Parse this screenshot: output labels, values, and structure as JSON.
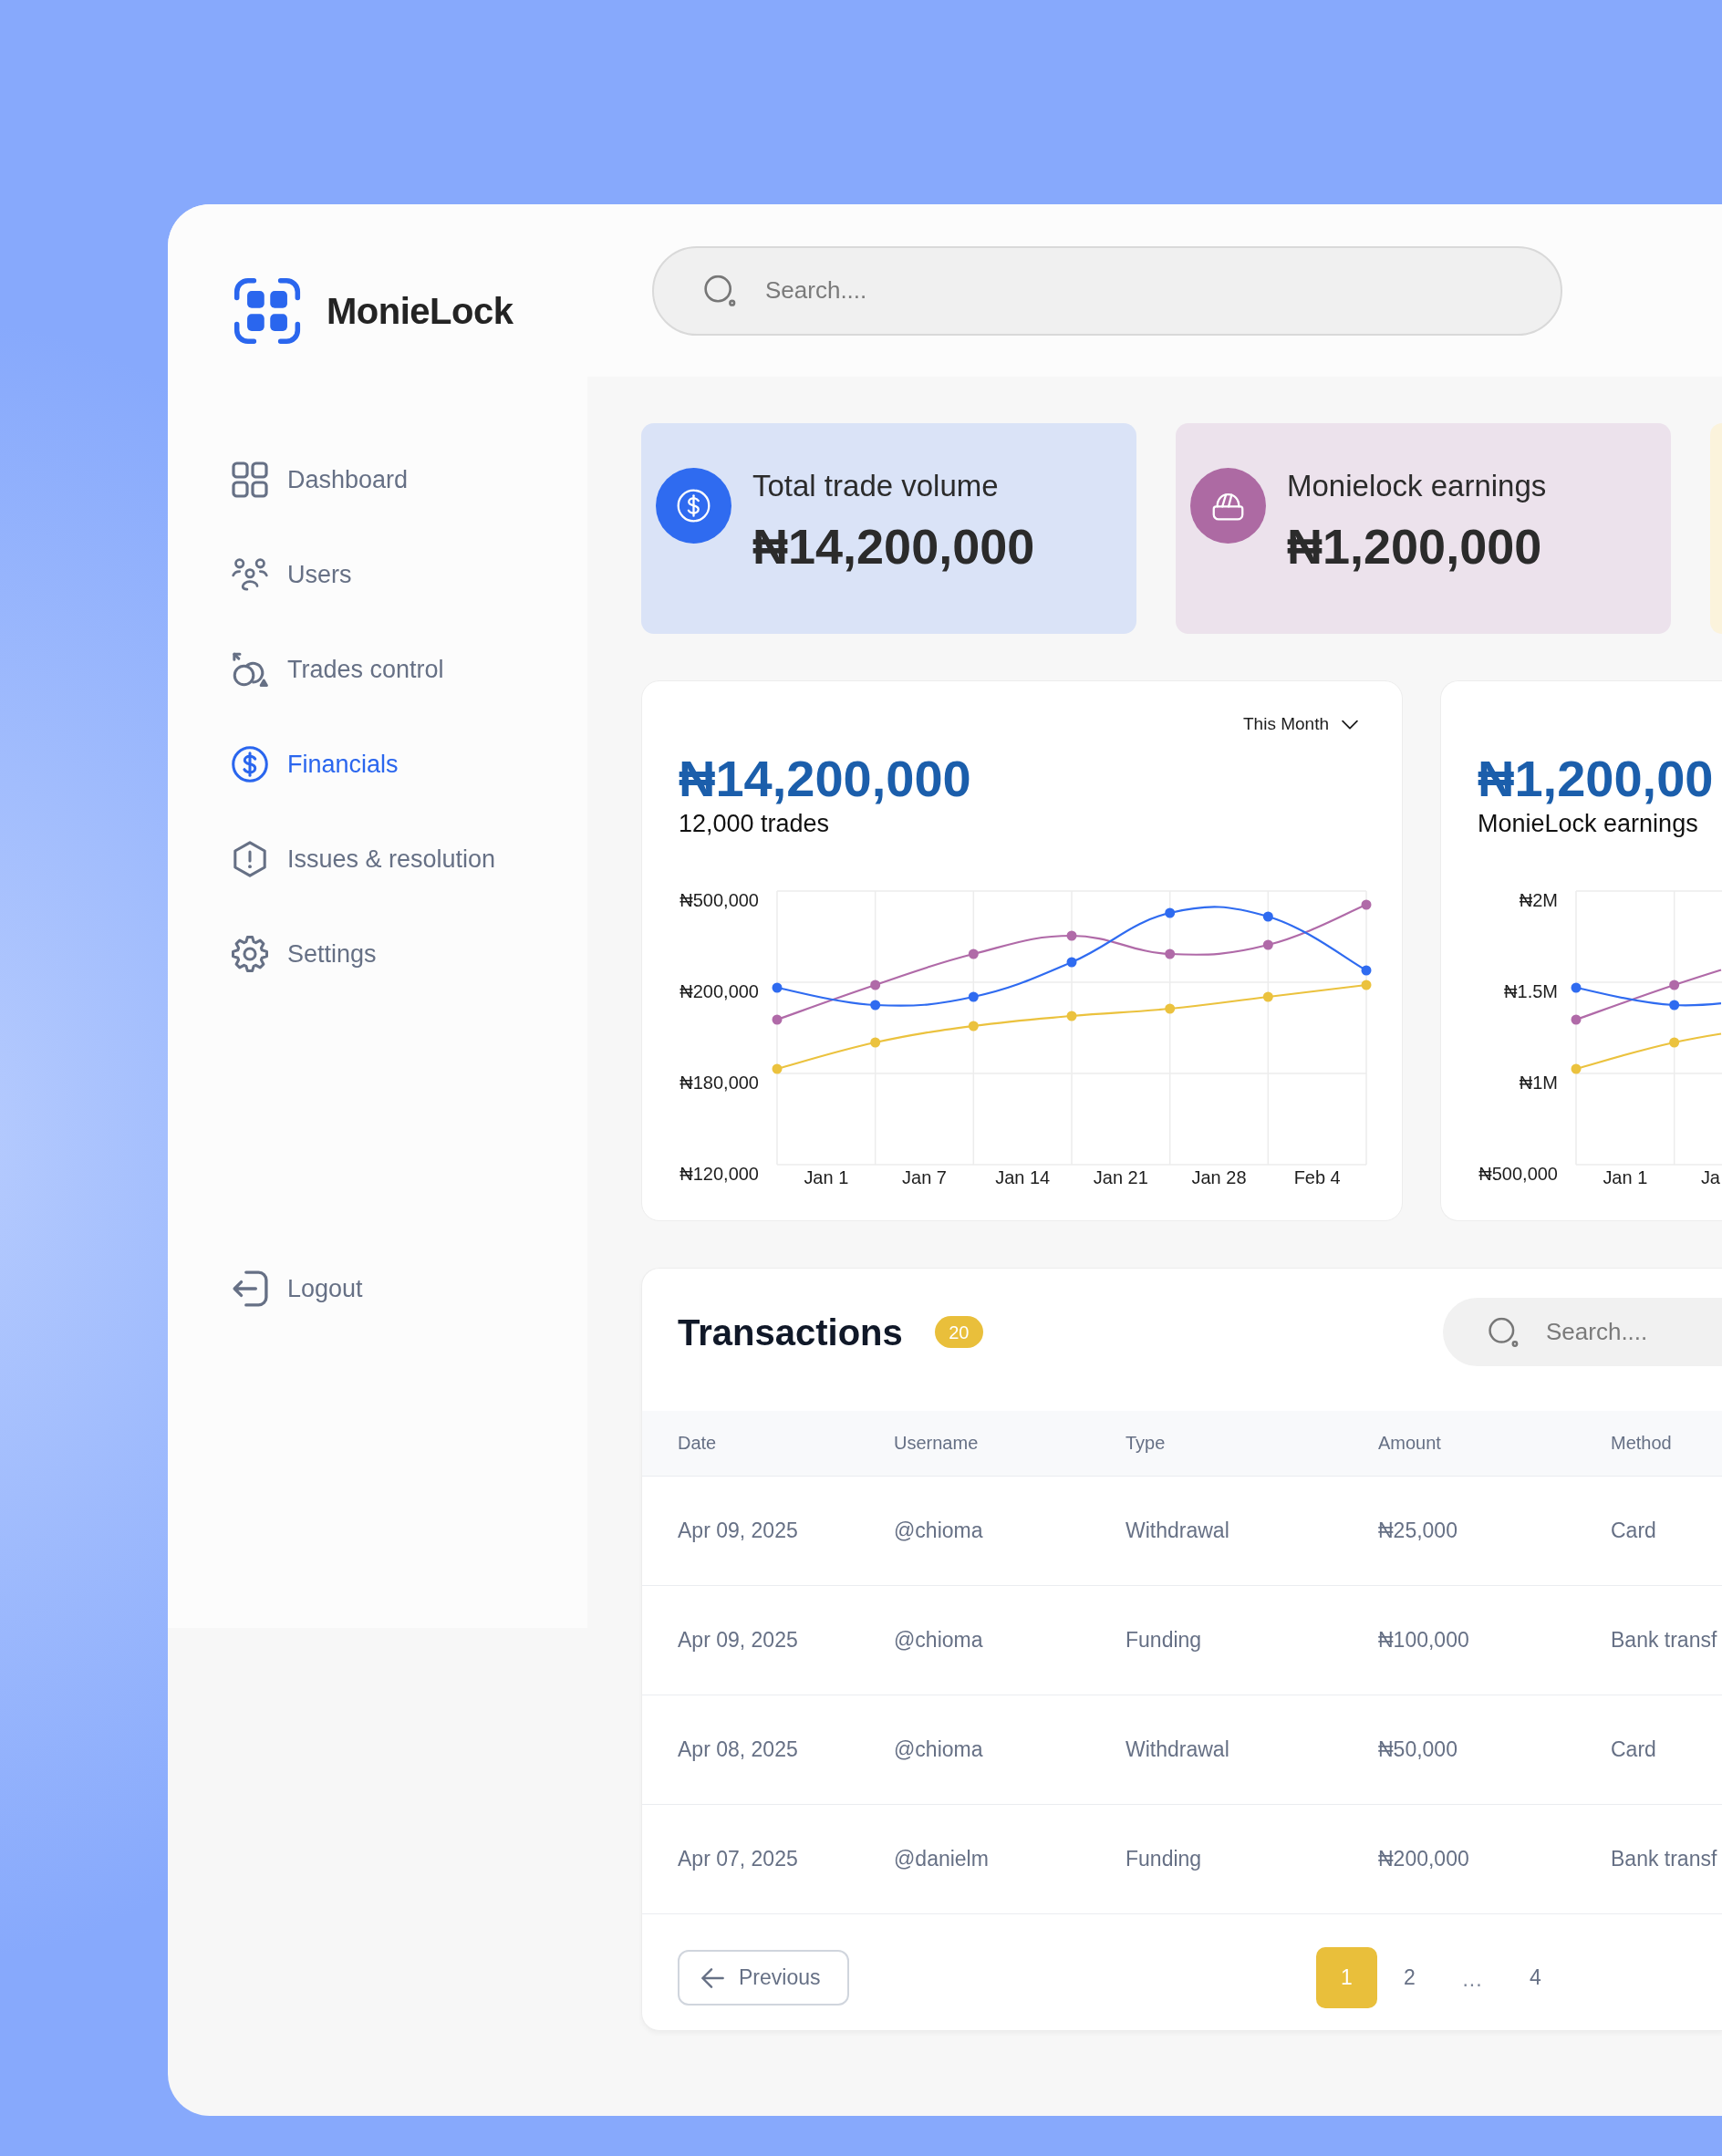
{
  "brand": {
    "name": "MonieLock"
  },
  "sidebar": {
    "items": [
      {
        "label": "Dashboard",
        "selected": false
      },
      {
        "label": "Users",
        "selected": false
      },
      {
        "label": "Trades control",
        "selected": false
      },
      {
        "label": "Financials",
        "selected": true
      },
      {
        "label": "Issues & resolution",
        "selected": false
      },
      {
        "label": "Settings",
        "selected": false
      }
    ],
    "logout": {
      "label": "Logout"
    }
  },
  "search": {
    "placeholder": "Search...."
  },
  "stat_cards": [
    {
      "title": "Total trade volume",
      "value": "₦14,200,000",
      "color": "#2f6bf0"
    },
    {
      "title": "Monielock earnings",
      "value": "₦1,200,000",
      "color": "#ad6aa3"
    }
  ],
  "charts": [
    {
      "period": "This Month",
      "value": "₦14,200,000",
      "caption": "12,000 trades",
      "y_axis_labels": [
        "₦500,000",
        "₦200,000",
        "₦180,000",
        "₦120,000"
      ],
      "x_axis_labels": [
        "Jan 1",
        "Jan 7",
        "Jan 14",
        "Jan 21",
        "Jan 28",
        "Feb 4"
      ]
    },
    {
      "value": "₦1,200,00",
      "caption": "MonieLock earnings",
      "y_axis_labels": [
        "₦2M",
        "₦1.5M",
        "₦1M",
        "₦500,000"
      ],
      "x_axis_labels": [
        "Jan 1",
        "Ja"
      ]
    }
  ],
  "transactions": {
    "title": "Transactions",
    "count": "20",
    "search": {
      "placeholder": "Search...."
    },
    "columns": [
      "Date",
      "Username",
      "Type",
      "Amount",
      "Method"
    ],
    "rows": [
      [
        "Apr 09, 2025",
        "@chioma",
        "Withdrawal",
        "₦25,000",
        "Card"
      ],
      [
        "Apr 09, 2025",
        "@chioma",
        "Funding",
        "₦100,000",
        "Bank transf"
      ],
      [
        "Apr 08, 2025",
        "@chioma",
        "Withdrawal",
        "₦50,000",
        "Card"
      ],
      [
        "Apr 07, 2025",
        "@danielm",
        "Funding",
        "₦200,000",
        "Bank transf"
      ]
    ],
    "pagination": {
      "previous": "Previous",
      "pages": [
        {
          "kind": "page",
          "label": "1",
          "selected": true
        },
        {
          "kind": "page",
          "label": "2",
          "selected": false
        },
        {
          "kind": "gap",
          "label": "...",
          "selected": false
        },
        {
          "kind": "page",
          "label": "4",
          "selected": false
        }
      ]
    }
  }
}
